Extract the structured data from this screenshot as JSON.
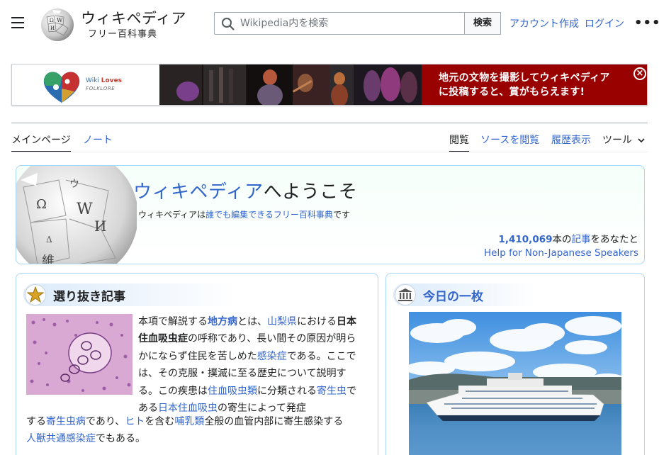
{
  "header": {
    "wordmark": "ウィキペディア",
    "tagline": "フリー百科事典",
    "search_placeholder": "Wikipedia内を検索",
    "search_button": "検索",
    "create_account": "アカウント作成",
    "login": "ログイン",
    "more": "•••"
  },
  "banner": {
    "logo_line1": "Wiki",
    "logo_line1_b": "Loves",
    "logo_line2": "FOLKLORE",
    "message_line1": "地元の文物を撮影してウィキペディア",
    "message_line2": "に投稿すると、賞がもらえます!",
    "close": "×"
  },
  "tabs": {
    "main_page": "メインページ",
    "talk": "ノート",
    "read": "閲覧",
    "view_source": "ソースを閲覧",
    "history": "履歴表示",
    "tools": "ツール"
  },
  "welcome": {
    "title_link": "ウィキペディア",
    "title_rest": "へようこそ",
    "sub_pre": "ウィキペディアは",
    "sub_link": "誰でも編集できるフリー百科事典",
    "sub_post": "です",
    "count": "1,410,069",
    "count_mid": "本の",
    "count_link": "記事",
    "count_post": "をあなたと",
    "help": "Help for Non-Japanese Speakers"
  },
  "featured": {
    "title": "選り抜き記事",
    "p1": "本項で解説する",
    "l1": "地方病",
    "p2": "とは、",
    "l2": "山梨県",
    "p3": "における",
    "b1": "日本住血吸虫症",
    "p4": "の呼称であり、長い間その原因が明らかにならず住民を苦しめた",
    "l3": "感染症",
    "p5": "である。ここでは、その克服・撲滅に至る歴史について説明する。この疾患は",
    "l4": "住血吸虫類",
    "p6": "に分類される",
    "l5": "寄生虫",
    "p7": "である",
    "l6": "日本住血吸虫",
    "p8": "の寄生によって発症",
    "p9": "する",
    "l7": "寄生虫病",
    "p10": "であり、",
    "l8": "ヒト",
    "p11": "を含む",
    "l9": "哺乳類",
    "p12": "全般の血管内部に寄生感染する",
    "l10": "人獣共通感染症",
    "p13": "でもある。"
  },
  "potd": {
    "title": "今日の一枚"
  },
  "colors": {
    "link": "#3366cc",
    "banner_red": "#990000",
    "card_border": "#a7d7f9"
  }
}
